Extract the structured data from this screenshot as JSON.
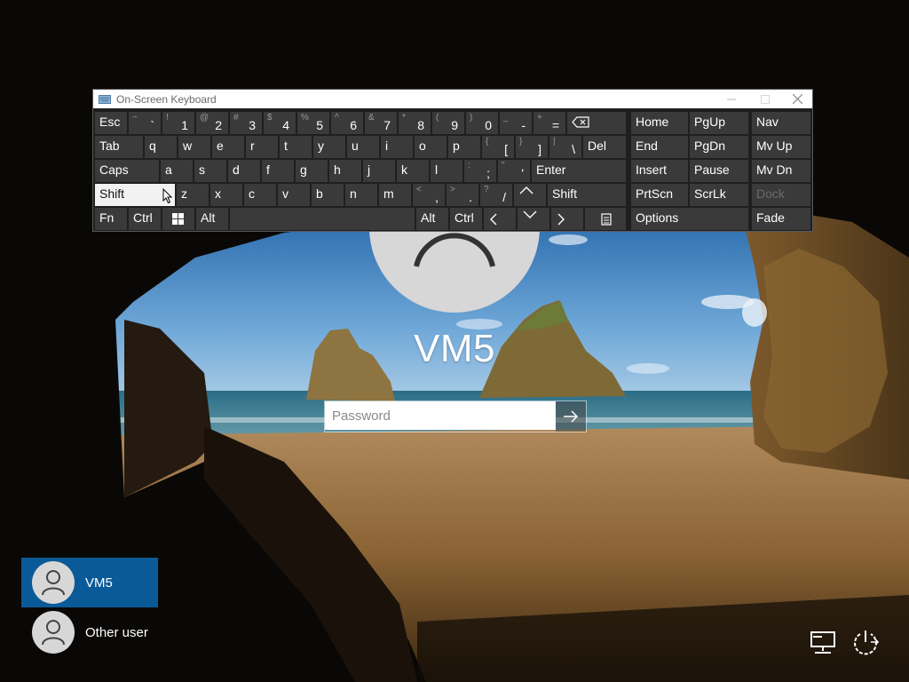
{
  "login": {
    "username": "VM5",
    "password_placeholder": "Password"
  },
  "users": [
    {
      "name": "VM5",
      "selected": true
    },
    {
      "name": "Other user",
      "selected": false
    }
  ],
  "corner_icons": [
    "network-icon",
    "power-icon"
  ],
  "osk": {
    "title": "On-Screen Keyboard",
    "rows": [
      [
        {
          "main": "Esc"
        },
        {
          "shift": "~",
          "main": "`"
        },
        {
          "shift": "!",
          "main": "1"
        },
        {
          "shift": "@",
          "main": "2"
        },
        {
          "shift": "#",
          "main": "3"
        },
        {
          "shift": "$",
          "main": "4"
        },
        {
          "shift": "%",
          "main": "5"
        },
        {
          "shift": "^",
          "main": "6"
        },
        {
          "shift": "&",
          "main": "7"
        },
        {
          "shift": "*",
          "main": "8"
        },
        {
          "shift": "(",
          "main": "9"
        },
        {
          "shift": ")",
          "main": "0"
        },
        {
          "shift": "_",
          "main": "-"
        },
        {
          "shift": "+",
          "main": "="
        },
        {
          "icon": "backspace-icon"
        }
      ],
      [
        {
          "main": "Tab"
        },
        {
          "main": "q"
        },
        {
          "main": "w"
        },
        {
          "main": "e"
        },
        {
          "main": "r"
        },
        {
          "main": "t"
        },
        {
          "main": "y"
        },
        {
          "main": "u"
        },
        {
          "main": "i"
        },
        {
          "main": "o"
        },
        {
          "main": "p"
        },
        {
          "shift": "{",
          "main": "["
        },
        {
          "shift": "}",
          "main": "]"
        },
        {
          "shift": "|",
          "main": "\\"
        },
        {
          "main": "Del"
        }
      ],
      [
        {
          "main": "Caps"
        },
        {
          "main": "a"
        },
        {
          "main": "s"
        },
        {
          "main": "d"
        },
        {
          "main": "f"
        },
        {
          "main": "g"
        },
        {
          "main": "h"
        },
        {
          "main": "j"
        },
        {
          "main": "k"
        },
        {
          "main": "l"
        },
        {
          "shift": ":",
          "main": ";"
        },
        {
          "shift": "\"",
          "main": "'"
        },
        {
          "main": "Enter"
        }
      ],
      [
        {
          "main": "Shift",
          "active": true
        },
        {
          "main": "z"
        },
        {
          "main": "x"
        },
        {
          "main": "c"
        },
        {
          "main": "v"
        },
        {
          "main": "b"
        },
        {
          "main": "n"
        },
        {
          "main": "m"
        },
        {
          "shift": "<",
          "main": ","
        },
        {
          "shift": ">",
          "main": "."
        },
        {
          "shift": "?",
          "main": "/"
        },
        {
          "icon": "arrow-up-icon"
        },
        {
          "main": "Shift"
        }
      ],
      [
        {
          "main": "Fn"
        },
        {
          "main": "Ctrl"
        },
        {
          "icon": "windows-icon"
        },
        {
          "main": "Alt"
        },
        {
          "main": ""
        },
        {
          "main": "Alt"
        },
        {
          "main": "Ctrl"
        },
        {
          "icon": "arrow-left-icon"
        },
        {
          "icon": "arrow-down-icon"
        },
        {
          "icon": "arrow-right-icon"
        },
        {
          "icon": "menu-key-icon"
        }
      ]
    ],
    "nav_keys": [
      [
        {
          "main": "Home"
        },
        {
          "main": "PgUp"
        },
        {
          "main": "Nav"
        }
      ],
      [
        {
          "main": "End"
        },
        {
          "main": "PgDn"
        },
        {
          "main": "Mv Up"
        }
      ],
      [
        {
          "main": "Insert"
        },
        {
          "main": "Pause"
        },
        {
          "main": "Mv Dn"
        }
      ],
      [
        {
          "main": "PrtScn"
        },
        {
          "main": "ScrLk"
        },
        {
          "main": "Dock",
          "disabled": true
        }
      ],
      [
        {
          "main": "Options"
        },
        {
          "main": "Fade"
        }
      ]
    ]
  }
}
